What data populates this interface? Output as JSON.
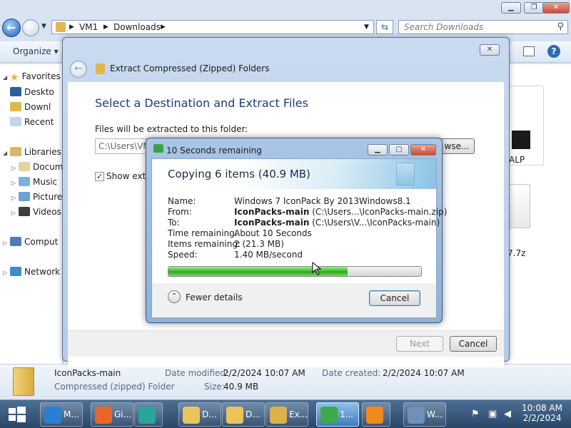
{
  "explorer": {
    "breadcrumb": [
      "VM1",
      "Downloads"
    ],
    "search_placeholder": "Search Downloads",
    "toolbar": {
      "organize": "Organize"
    },
    "nav": {
      "favorites": "Favorites",
      "desktop": "Deskto",
      "downloads": "Downl",
      "recent": "Recent",
      "libraries": "Libraries",
      "documents": "Docum",
      "music": "Music",
      "pictures": "Picture",
      "videos": "Videos",
      "computer": "Comput",
      "network": "Network"
    },
    "content": {
      "item1_label": "ALP",
      "item2_label": "7.7z"
    },
    "details": {
      "name": "IconPacks-main",
      "type": "Compressed (zipped) Folder",
      "date_modified_label": "Date modified:",
      "date_modified": "2/2/2024 10:07 AM",
      "date_created_label": "Date created:",
      "date_created": "2/2/2024 10:07 AM",
      "size_label": "Size:",
      "size": "40.9 MB"
    }
  },
  "wizard": {
    "title": "Extract Compressed (Zipped) Folders",
    "heading": "Select a Destination and Extract Files",
    "folder_label": "Files will be extracted to this folder:",
    "folder_path": "C:\\Users\\VM",
    "browse_label": "wse...",
    "show_label": "Show extra",
    "next_label": "Next",
    "cancel_label": "Cancel"
  },
  "progress": {
    "title": "10 Seconds remaining",
    "header": "Copying 6 items (40.9 MB)",
    "rows": [
      {
        "label": "Name:",
        "value": "Windows 7 IconPack By 2013Windows8.1",
        "bold": ""
      },
      {
        "label": "From:",
        "value": "(C:\\Users...\\IconPacks-main.zip)",
        "bold": "IconPacks-main"
      },
      {
        "label": "To:",
        "value": "(C:\\Users\\V...\\IconPacks-main)",
        "bold": "IconPacks-main"
      },
      {
        "label": "Time remaining:",
        "value": "About 10 Seconds",
        "bold": ""
      },
      {
        "label": "Items remaining:",
        "value": "2 (21.3 MB)",
        "bold": ""
      },
      {
        "label": "Speed:",
        "value": "1.40 MB/second",
        "bold": ""
      }
    ],
    "progress_fraction": 0.71,
    "fewer_details": "Fewer details",
    "cancel_label": "Cancel"
  },
  "taskbar": {
    "items": [
      {
        "label": "M...",
        "icon": "ie-icon",
        "color": "#2a7fd4"
      },
      {
        "label": "Gi...",
        "icon": "firefox-icon",
        "color": "#e8662a"
      },
      {
        "label": "",
        "icon": "edge-icon",
        "color": "#2aa59a"
      },
      {
        "label": "D...",
        "icon": "folder-icon",
        "color": "#e9c55b"
      },
      {
        "label": "D...",
        "icon": "folder-icon",
        "color": "#e9c55b"
      },
      {
        "label": "Ex...",
        "icon": "zip-folder-icon",
        "color": "#d9b349"
      },
      {
        "label": "1...",
        "icon": "copy-icon",
        "color": "#3da84c"
      },
      {
        "label": "",
        "icon": "media-player-icon",
        "color": "#f08a1c"
      },
      {
        "label": "W...",
        "icon": "window-icon",
        "color": "#6d8fb8"
      }
    ],
    "time": "10:08 AM",
    "date": "2/2/2024"
  }
}
